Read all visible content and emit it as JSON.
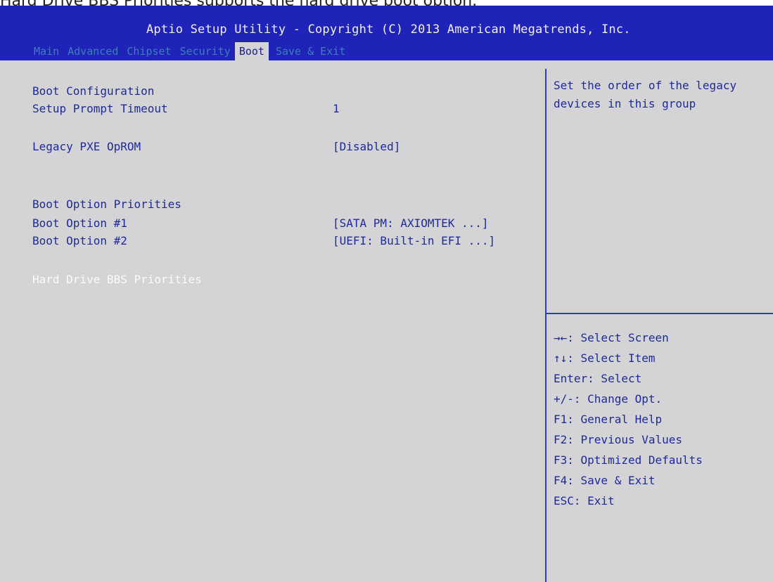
{
  "caption": "Hard Drive BBS Priorities supports the hard drive boot option.",
  "header": {
    "title": "Aptio Setup Utility - Copyright (C) 2013 American Megatrends, Inc.",
    "tabs": [
      "Main",
      "Advanced",
      "Chipset",
      "Security",
      "Boot",
      "Save & Exit"
    ],
    "active_tab": "Boot"
  },
  "settings": {
    "boot_configuration": "Boot Configuration",
    "setup_prompt_timeout": {
      "label": "Setup Prompt Timeout",
      "value": "1"
    },
    "legacy_pxe_oprom": {
      "label": "Legacy PXE OpROM",
      "value": "[Disabled]"
    },
    "boot_option_priorities": "Boot Option Priorities",
    "boot_option_1": {
      "label": "Boot Option #1",
      "value": "[SATA  PM: AXIOMTEK ...]"
    },
    "boot_option_2": {
      "label": "Boot Option #2",
      "value": "[UEFI: Built-in EFI ...]"
    },
    "hard_drive_bbs": "Hard Drive BBS Priorities"
  },
  "help": {
    "line1": "Set the order of the legacy",
    "line2": "devices in this group"
  },
  "keys": [
    "→←: Select Screen",
    "↑↓: Select Item",
    "Enter: Select",
    "+/-: Change Opt.",
    "F1: General Help",
    "F2: Previous Values",
    "F3: Optimized Defaults",
    "F4: Save & Exit",
    "ESC: Exit"
  ],
  "colors": {
    "header_bg": "#1f23b8",
    "screen_bg": "#d4d4d6",
    "text": "#1e2a9a",
    "highlight": "#fafafa"
  }
}
